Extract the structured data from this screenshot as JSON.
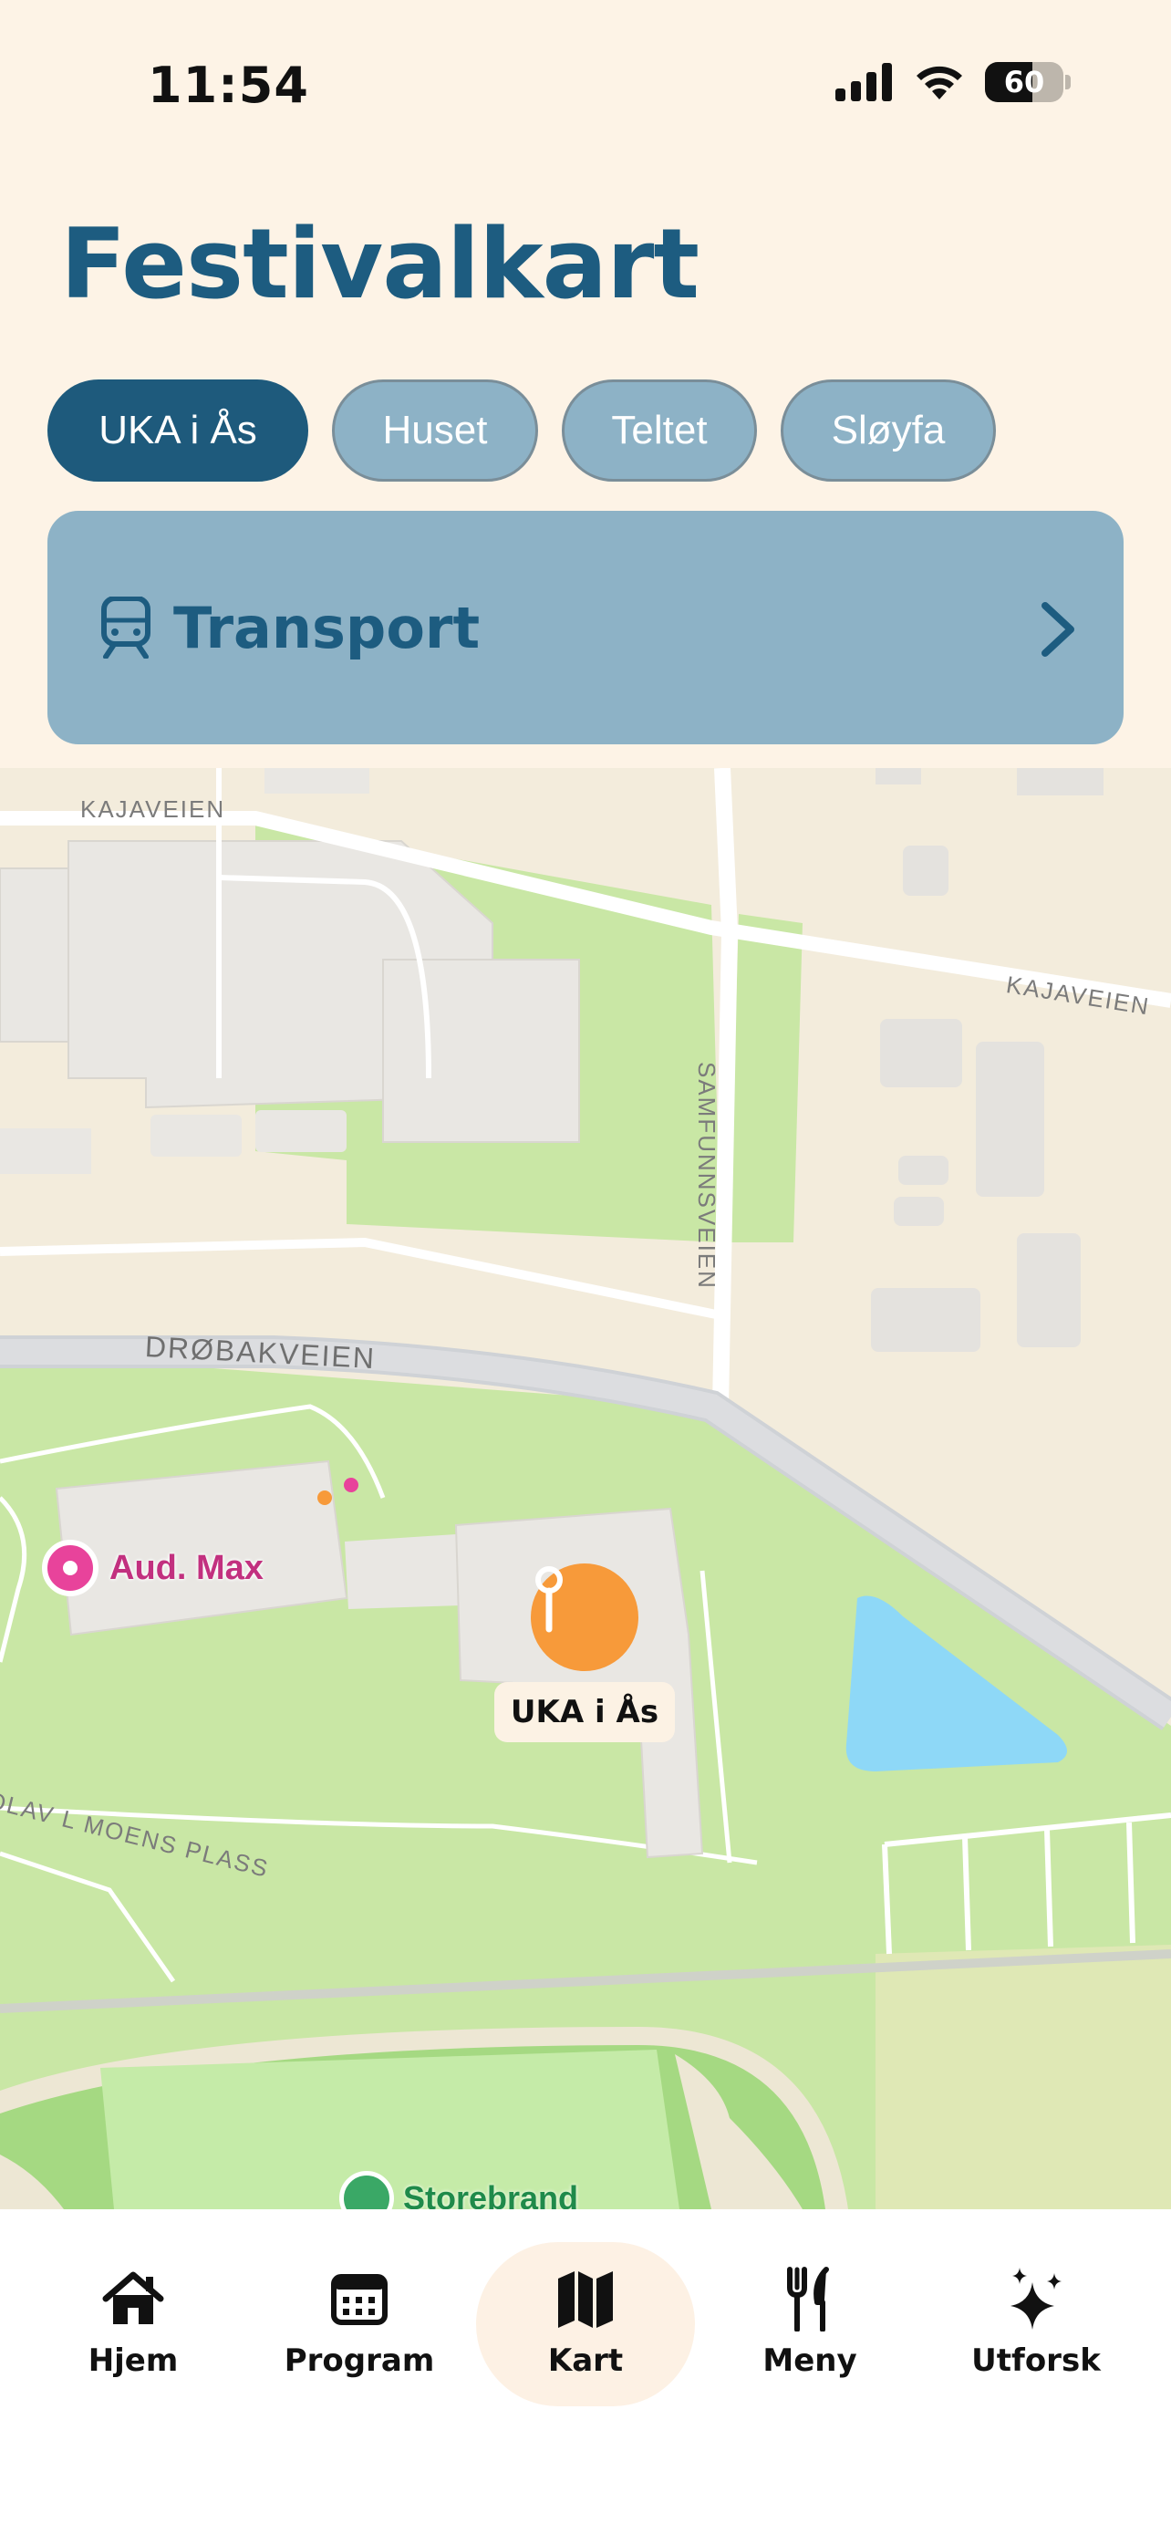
{
  "status_bar": {
    "time": "11:54",
    "battery": "60",
    "battery_level_percent": 60
  },
  "header": {
    "title": "Festivalkart"
  },
  "tabs": [
    {
      "label": "UKA i Ås",
      "active": true
    },
    {
      "label": "Huset",
      "active": false
    },
    {
      "label": "Teltet",
      "active": false
    },
    {
      "label": "Sløyfa",
      "active": false
    }
  ],
  "transport": {
    "label": "Transport",
    "icon": "train-icon"
  },
  "map": {
    "street_labels": {
      "kajaveien_1": "KAJAVEIEN",
      "kajaveien_2": "KAJAVEIEN",
      "samfunnsveien": "SAMFUNNSVEIEN",
      "drobakveien": "DRØBAKVEIEN",
      "olav_moens": "OLAV L MOENS PLASS"
    },
    "poi_aud_max": "Aud. Max",
    "selected_pin": "UKA i Ås",
    "poi_storebrand": "Storebrand"
  },
  "nav": [
    {
      "label": "Hjem",
      "icon": "home-icon",
      "active": false
    },
    {
      "label": "Program",
      "icon": "calendar-icon",
      "active": false
    },
    {
      "label": "Kart",
      "icon": "map-icon",
      "active": true
    },
    {
      "label": "Meny",
      "icon": "fork-knife-icon",
      "active": false
    },
    {
      "label": "Utforsk",
      "icon": "sparkles-icon",
      "active": false
    }
  ],
  "colors": {
    "background": "#fdf3e6",
    "primary": "#1d5c80",
    "tab_inactive": "#8db2c6",
    "pin": "#f79a3a",
    "aud_poi": "#e8439b"
  }
}
